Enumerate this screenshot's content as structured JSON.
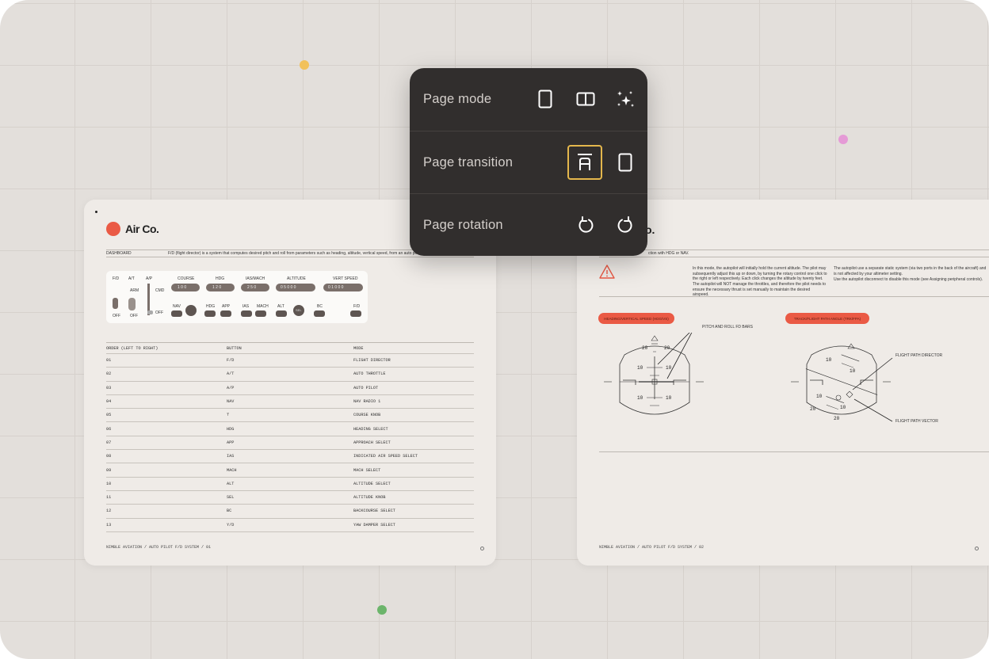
{
  "colors": {
    "accent": "#ea5a45",
    "selection": "#e4b74c",
    "menu_bg": "#312e2d",
    "dot_yellow": "#f2c15a",
    "dot_pink": "#e59ad6",
    "dot_green": "#6cb56b"
  },
  "menu": {
    "rows": [
      {
        "label": "Page mode",
        "buttons": [
          "single-page-icon",
          "two-page-icon",
          "sparkle-icon"
        ]
      },
      {
        "label": "Page transition",
        "buttons": [
          "page-curl-icon",
          "page-slide-icon"
        ],
        "selected": "page-curl-icon"
      },
      {
        "label": "Page rotation",
        "buttons": [
          "rotate-left-icon",
          "rotate-right-icon"
        ]
      }
    ]
  },
  "left_page": {
    "brand": "Air Co.",
    "section": "DASHBOARD",
    "intro": "F/D (flight director) is a system that computes desired pitch and roll from parameters such as heading, altitude, vertical speed, from an auto pilot computes control surfaces com",
    "panel": {
      "switch_labels": [
        "F/D",
        "A/T",
        "A/P"
      ],
      "switch_states": [
        "OFF",
        "OFF",
        "ARM",
        "CMD",
        "OFF"
      ],
      "displays": [
        {
          "label": "COURSE",
          "value": "1 0 0"
        },
        {
          "label": "HDG",
          "value": "1 2 0"
        },
        {
          "label": "IAS/MACH",
          "value": "2 5 0"
        },
        {
          "label": "ALTITUDE",
          "value": "0 5 0 0 0"
        },
        {
          "label": "VERT SPEED",
          "value": "0 1 0 0 0"
        }
      ],
      "buttons": [
        "NAV",
        "HDG",
        "APP",
        "IAS",
        "MACH",
        "ALT",
        "SEL",
        "BC",
        "F/D"
      ]
    },
    "table": {
      "headers": [
        "ORDER (LEFT TO RIGHT)",
        "BUTTON",
        "MODE"
      ],
      "rows": [
        [
          "01",
          "F/D",
          "FLIGHT DIRECTOR"
        ],
        [
          "02",
          "A/T",
          "AUTO THROTTLE"
        ],
        [
          "03",
          "A/P",
          "AUTO PILOT"
        ],
        [
          "04",
          "NAV",
          "NAV RADIO 1"
        ],
        [
          "05",
          "⊤",
          "COURSE KNOB"
        ],
        [
          "06",
          "HDG",
          "HEADING SELECT"
        ],
        [
          "07",
          "APP",
          "APPROACH SELECT"
        ],
        [
          "08",
          "IAS",
          "INDICATED AIR SPEED SELECT"
        ],
        [
          "09",
          "MACH",
          "MACH SELECT"
        ],
        [
          "10",
          "ALT",
          "ALTITUDE SELECT"
        ],
        [
          "11",
          "SEL",
          "ALTITUDE KNOB"
        ],
        [
          "12",
          "BC",
          "BACKCOURSE SELECT"
        ],
        [
          "13",
          "Y/D",
          "YAW DAMPER SELECT"
        ]
      ]
    },
    "footer": "NIMBLE AVIATION / AUTO PILOT F/D SYSTEM / 01"
  },
  "right_page": {
    "brand_partial": "o.",
    "header_note": "ction with HDG or NAV.",
    "col1_p1": "In this mode, the autopilot will initially hold the current altitude. The pilot may subsequently adjust this up or down, by turning the rotary control one click to the right or left respectively. Each click changes the altitude by twenty feet.",
    "col1_p2": "The autopilot will NOT manage the throttles, and therefore the pilot needs to ensure the necessary thrust is set manually to maintain the desired airspeed.",
    "col2_p1": "The autopilot use a separate static system (via two ports in the back of the aircraft) and is not affected by your altimeter setting.",
    "col2_p2": "Use the autopilot disconnect to disable this mode (see Assigning peripheral controls).",
    "tag1": "HEADING/VERTICAL SPEED (HDG/VS)",
    "tag2": "TRACK/FLIGHT PATH ANGLE (TRK/FPA)",
    "callout1": "PITCH AND ROLL FD BARS",
    "callout2": "FLIGHT PATH DIRECTOR",
    "callout3": "FLIGHT PATH VECTOR",
    "pitch_marks": [
      "20",
      "10",
      "10",
      "10"
    ],
    "footer": "NIMBLE AVIATION / AUTO PILOT F/D SYSTEM / 02"
  }
}
